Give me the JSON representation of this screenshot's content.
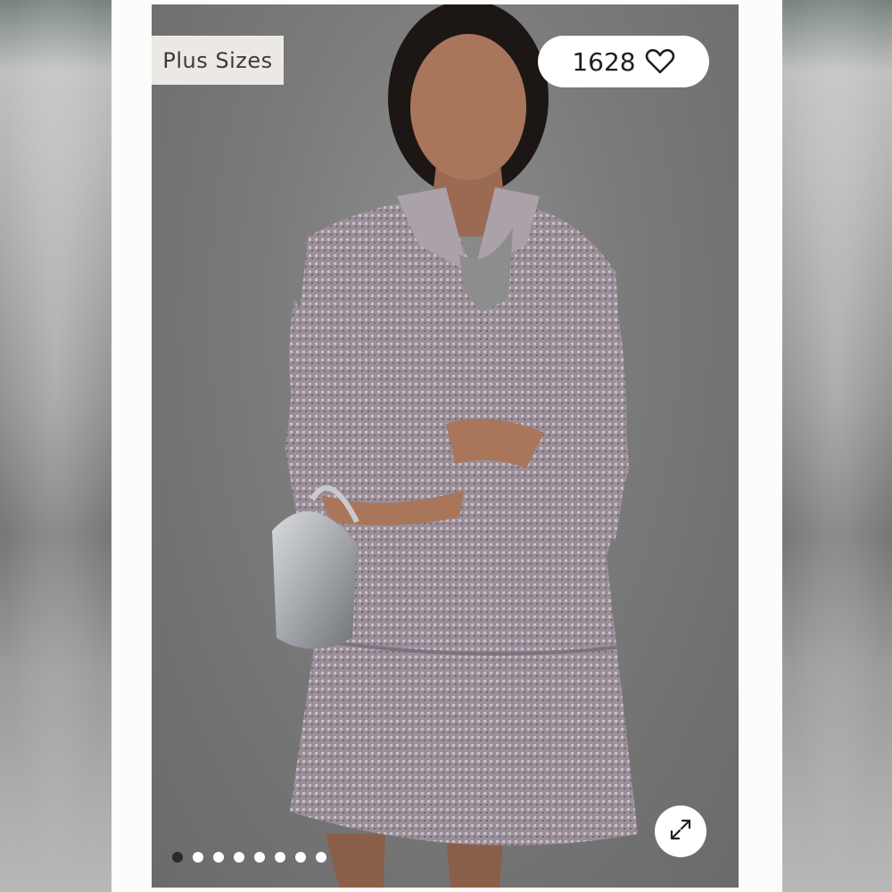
{
  "product": {
    "tag_label": "Plus Sizes",
    "like_count": "1628",
    "colors": {
      "dress": "#9b9199",
      "background": "#7a7a7a",
      "bag": "#b9bcc0"
    }
  },
  "icons": {
    "like": "heart-icon",
    "expand": "expand-arrows-icon"
  },
  "carousel": {
    "total_slides": 8,
    "active_index": 0
  }
}
